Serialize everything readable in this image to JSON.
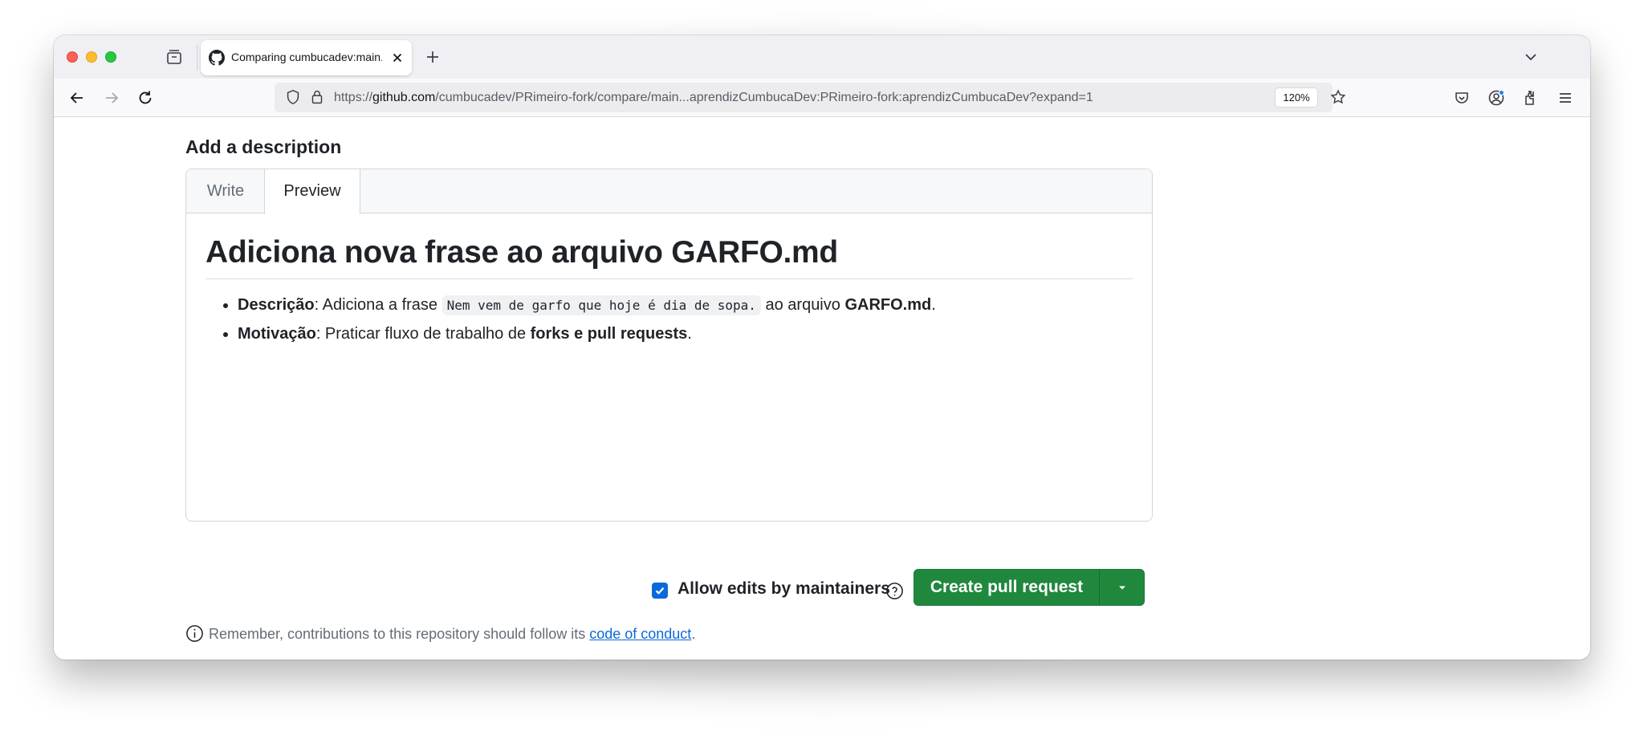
{
  "browser": {
    "tab": {
      "title": "Comparing cumbucadev:main...",
      "favicon": "github-icon"
    },
    "url": {
      "protocol": "https://",
      "host": "github.com",
      "path": "/cumbucadev/PRimeiro-fork/compare/main...aprendizCumbucaDev:PRimeiro-fork:aprendizCumbucaDev?expand=1"
    },
    "zoom": "120%"
  },
  "form": {
    "heading": "Add a description",
    "tabs": {
      "write": "Write",
      "preview": "Preview",
      "active": "preview"
    },
    "preview": {
      "title": "Adiciona nova frase ao arquivo GARFO.md",
      "items": [
        {
          "label": "Descrição",
          "text_before": ": Adiciona a frase ",
          "code": "Nem vem de garfo que hoje é dia de sopa.",
          "text_middle": " ao arquivo ",
          "bold_end": "GARFO.md",
          "text_end": "."
        },
        {
          "label": "Motivação",
          "text_before": ": Praticar fluxo de trabalho de ",
          "bold_end": "forks e pull requests",
          "text_end": "."
        }
      ]
    },
    "allow_edits": {
      "label": "Allow edits by maintainers",
      "checked": true
    },
    "create_button": {
      "label": "Create pull request",
      "color": "#1f883d"
    },
    "notice": {
      "text_before": "Remember, contributions to this repository should follow its ",
      "link": "code of conduct",
      "text_after": "."
    }
  },
  "colors": {
    "accent": "#0969da",
    "success": "#1f883d"
  }
}
